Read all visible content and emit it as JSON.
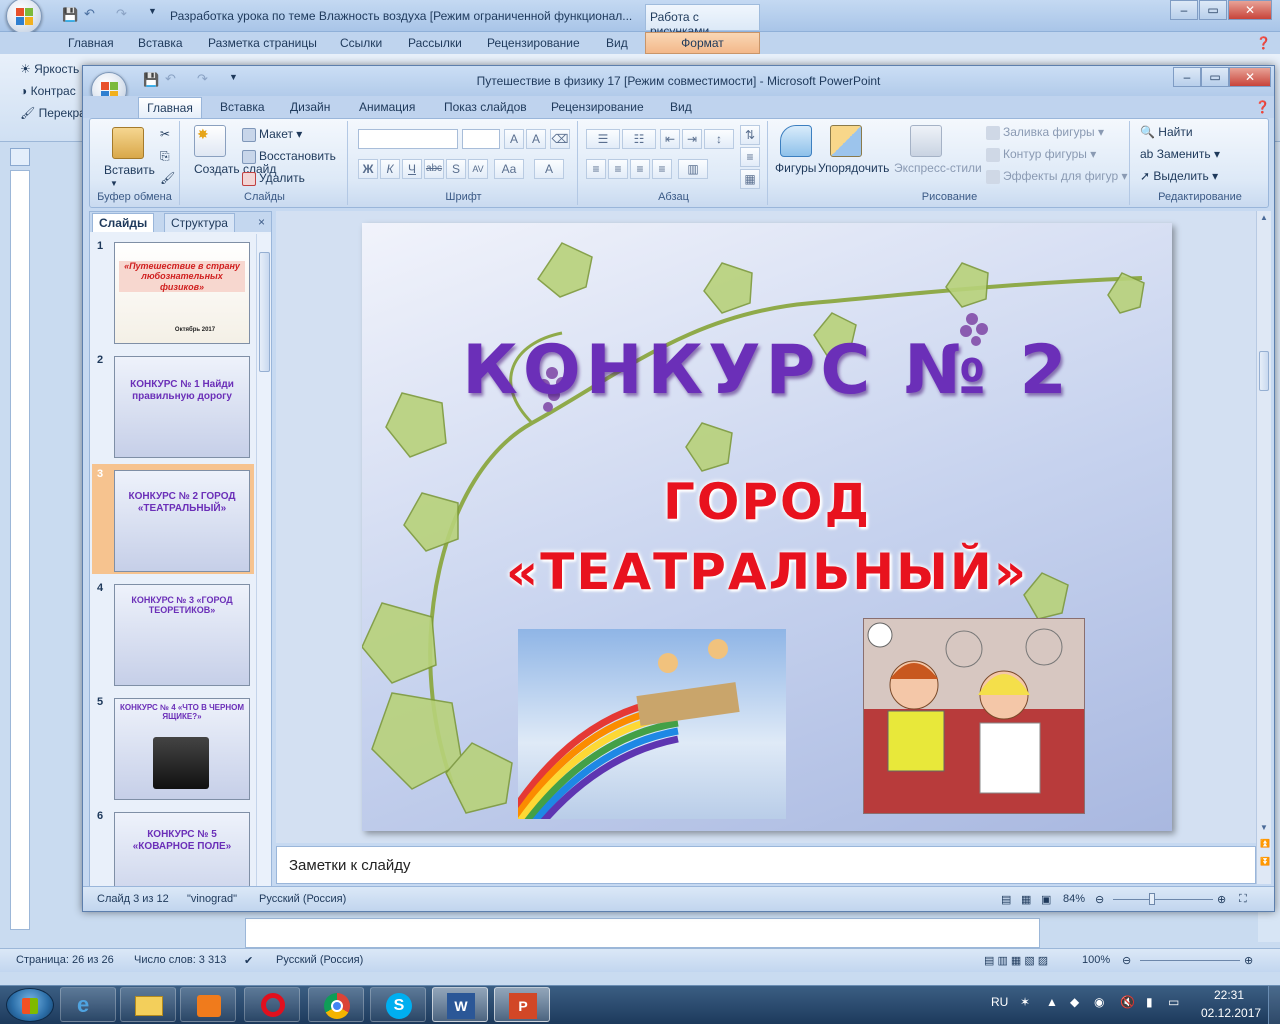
{
  "word": {
    "title": "Разработка урока по теме Влажность воздуха [Режим ограниченной функционал...",
    "context_tab_title": "Работа с рисунками",
    "tabs": [
      "Главная",
      "Вставка",
      "Разметка страницы",
      "Ссылки",
      "Рассылки",
      "Рецензирование",
      "Вид"
    ],
    "context_tab": "Формат",
    "ribbon_items": [
      "Яркость",
      "Контрас",
      "Перекра"
    ],
    "status": {
      "page": "Страница: 26 из 26",
      "words": "Число слов: 3 313",
      "lang": "Русский (Россия)",
      "zoom": "100%"
    }
  },
  "ppt": {
    "title": "Путешествие  в физику 17 [Режим совместимости] - Microsoft PowerPoint",
    "tabs": [
      "Главная",
      "Вставка",
      "Дизайн",
      "Анимация",
      "Показ слайдов",
      "Рецензирование",
      "Вид"
    ],
    "ribbon": {
      "clipboard": {
        "label": "Буфер обмена",
        "paste": "Вставить"
      },
      "slides": {
        "label": "Слайды",
        "new": "Создать слайд",
        "layout": "Макет",
        "reset": "Восстановить",
        "delete": "Удалить"
      },
      "font": {
        "label": "Шрифт"
      },
      "paragraph": {
        "label": "Абзац"
      },
      "drawing": {
        "label": "Рисование",
        "shapes": "Фигуры",
        "arrange": "Упорядочить",
        "quick_styles": "Экспресс-стили",
        "fill": "Заливка фигуры",
        "outline": "Контур фигуры",
        "effects": "Эффекты для фигур"
      },
      "editing": {
        "label": "Редактирование",
        "find": "Найти",
        "replace": "Заменить",
        "select": "Выделить"
      }
    },
    "pane": {
      "tab_slides": "Слайды",
      "tab_outline": "Структура",
      "close": "×",
      "thumbs": [
        {
          "num": "1",
          "text": "«Путешествие в страну любознательных физиков»",
          "date": "Октябрь 2017"
        },
        {
          "num": "2",
          "text": "КОНКУРС № 1 Найди правильную дорогу"
        },
        {
          "num": "3",
          "text": "КОНКУРС № 2 ГОРОД «ТЕАТРАЛЬНЫЙ»"
        },
        {
          "num": "4",
          "text": "КОНКУРС № 3 «ГОРОД ТЕОРЕТИКОВ»"
        },
        {
          "num": "5",
          "text": "КОНКУРС № 4 «ЧТО В ЧЕРНОМ ЯЩИКЕ?»"
        },
        {
          "num": "6",
          "text": "КОНКУРС № 5 «КОВАРНОЕ ПОЛЕ»"
        }
      ]
    },
    "slide": {
      "title": "КОНКУРС № 2",
      "sub1": "ГОРОД",
      "sub2": "«ТЕАТРАЛЬНЫЙ»"
    },
    "notes_placeholder": "Заметки к слайду",
    "status": {
      "slide": "Слайд 3 из 12",
      "theme": "\"vinograd\"",
      "lang": "Русский (Россия)",
      "zoom": "84%"
    }
  },
  "taskbar": {
    "lang": "RU",
    "time": "22:31",
    "date": "02.12.2017"
  }
}
